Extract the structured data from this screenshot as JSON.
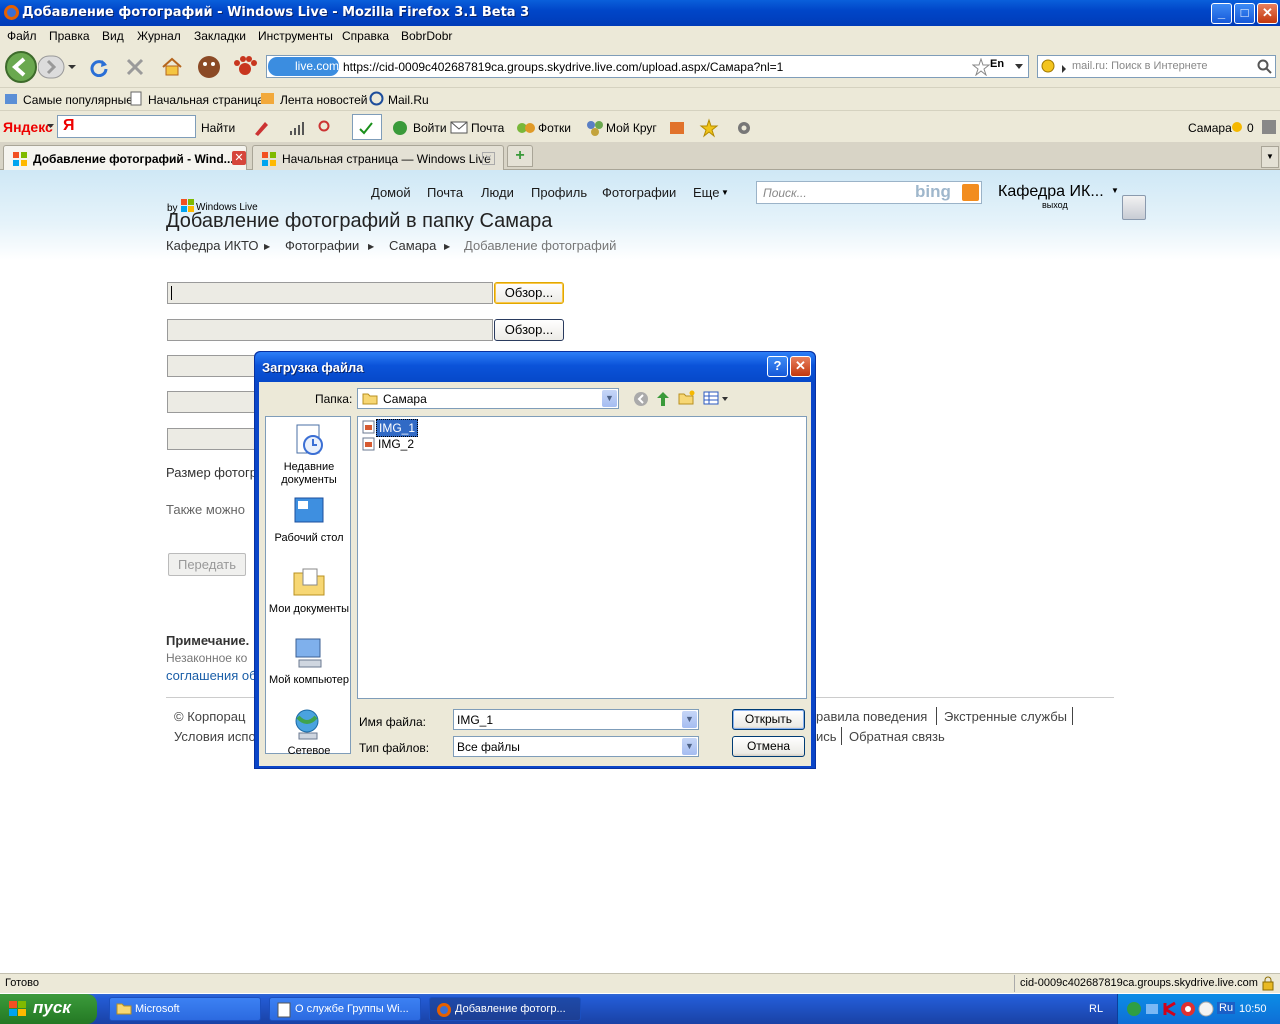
{
  "window": {
    "title": "Добавление фотографий - Windows Live - Mozilla Firefox 3.1 Beta 3"
  },
  "menu": [
    "Файл",
    "Правка",
    "Вид",
    "Журнал",
    "Закладки",
    "Инструменты",
    "Справка",
    "BobrDobr"
  ],
  "navbar": {
    "site_badge": "live.com",
    "url": "https://cid-0009c402687819ca.groups.skydrive.live.com/upload.aspx/Самара?nl=1",
    "lang": "En",
    "search_placeholder": "mail.ru: Поиск в Интернете"
  },
  "bookmarks": [
    "Самые популярные",
    "Начальная страница",
    "Лента новостей",
    "Mail.Ru"
  ],
  "yandex_bar": {
    "brand": "Яндекс",
    "find": "Найти",
    "login": "Войти",
    "mail": "Почта",
    "photos": "Фотки",
    "circle": "Мой Круг",
    "city": "Самара",
    "weather_count": "0"
  },
  "tabs": [
    {
      "label": "Добавление фотографий - Wind...",
      "active": true
    },
    {
      "label": "Начальная страница — Windows Live",
      "active": false
    }
  ],
  "page": {
    "nav": [
      "Домой",
      "Почта",
      "Люди",
      "Профиль",
      "Фотографии",
      "Еще"
    ],
    "search_placeholder": "Поиск...",
    "bing": "bing",
    "user_name": "Кафедра ИК...",
    "signout": "выход",
    "brand_by": "by",
    "brand": "Windows Live",
    "heading": "Добавление фотографий в папку Самара",
    "breadcrumb": [
      "Кафедра ИКТО",
      "Фотографии",
      "Самара",
      "Добавление фотографий"
    ],
    "browse_label": "Обзор...",
    "size_text": "Размер фотогр",
    "also_text": "Также можно",
    "submit": "Передать",
    "note_title": "Примечание.",
    "note_text": "Незаконное ко",
    "note_link": "соглашения об",
    "footer_row1_left": "© Корпорац",
    "footer_row2_left": "Условия испо",
    "footer_row1_right": [
      "равила поведения",
      "Экстренные службы"
    ],
    "footer_row2_right": [
      "ись",
      "Обратная связь"
    ]
  },
  "dialog": {
    "title": "Загрузка файла",
    "folder_label": "Папка:",
    "folder_value": "Самара",
    "places": [
      "Недавние документы",
      "Рабочий стол",
      "Мои документы",
      "Мой компьютер",
      "Сетевое"
    ],
    "files": [
      "IMG_1",
      "IMG_2"
    ],
    "filename_label": "Имя файла:",
    "filename_value": "IMG_1",
    "filetype_label": "Тип файлов:",
    "filetype_value": "Все файлы",
    "open": "Открыть",
    "cancel": "Отмена"
  },
  "status": {
    "left": "Готово",
    "right": "cid-0009c402687819ca.groups.skydrive.live.com"
  },
  "taskbar": {
    "start": "пуск",
    "tasks": [
      "Microsoft",
      "О службе Группы Wi...",
      "Добавление фотогр..."
    ],
    "lang": "RL",
    "tray_lang": "Ru",
    "clock": "10:50"
  }
}
